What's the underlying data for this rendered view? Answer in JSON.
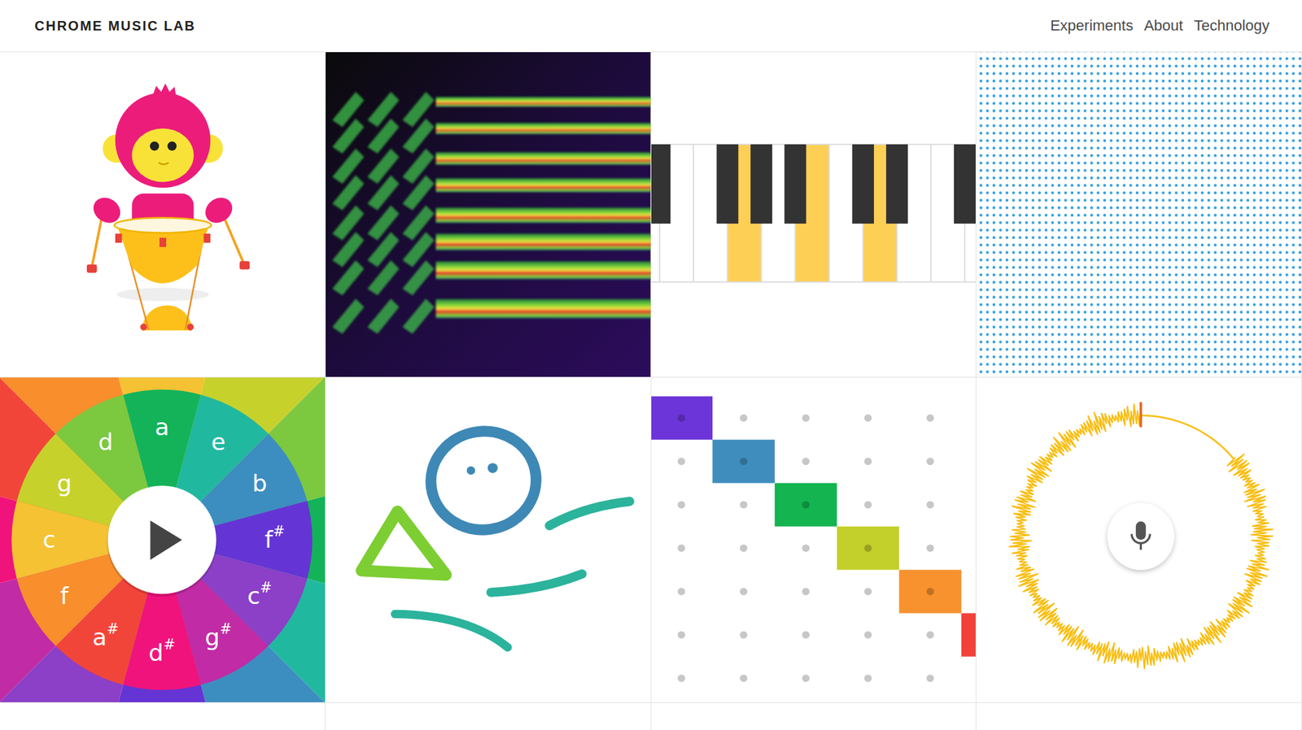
{
  "header": {
    "logo": "CHROME MUSIC LAB",
    "nav": [
      {
        "label": "Experiments"
      },
      {
        "label": "About"
      },
      {
        "label": "Technology"
      }
    ]
  },
  "experiments": [
    {
      "kind": "rhythm"
    },
    {
      "kind": "spectrogram"
    },
    {
      "kind": "chords",
      "keys": [
        {
          "active": false
        },
        {
          "active": false
        },
        {
          "active": false
        },
        {
          "active": true
        },
        {
          "active": false
        },
        {
          "active": true
        },
        {
          "active": false
        },
        {
          "active": true
        },
        {
          "active": false
        },
        {
          "active": false
        },
        {
          "active": false
        }
      ]
    },
    {
      "kind": "sound-waves"
    },
    {
      "kind": "arpeggios",
      "wedges": [
        {
          "note": "a",
          "accidental": "",
          "color": "#14b35a"
        },
        {
          "note": "e",
          "accidental": "",
          "color": "#21b8a0"
        },
        {
          "note": "b",
          "accidental": "",
          "color": "#3d8ec0"
        },
        {
          "note": "f",
          "accidental": "#",
          "color": "#6534d5"
        },
        {
          "note": "c",
          "accidental": "#",
          "color": "#8c3fc7"
        },
        {
          "note": "g",
          "accidental": "#",
          "color": "#c12ba5"
        },
        {
          "note": "d",
          "accidental": "#",
          "color": "#f0137c"
        },
        {
          "note": "a",
          "accidental": "#",
          "color": "#f2453a"
        },
        {
          "note": "f",
          "accidental": "",
          "color": "#f88e2c"
        },
        {
          "note": "c",
          "accidental": "",
          "color": "#f4c233"
        },
        {
          "note": "g",
          "accidental": "",
          "color": "#c6d12b"
        },
        {
          "note": "d",
          "accidental": "",
          "color": "#7cc83f"
        }
      ]
    },
    {
      "kind": "kandinsky"
    },
    {
      "kind": "melody-maker",
      "notes": [
        {
          "row": 0,
          "color": "#6c35d9"
        },
        {
          "row": 1,
          "color": "#3f8dbd"
        },
        {
          "row": 2,
          "color": "#14b450"
        },
        {
          "row": 3,
          "color": "#c3cf2a"
        },
        {
          "row": 4,
          "color": "#f7922f"
        },
        {
          "row": 5,
          "color": "#f2413a"
        }
      ]
    },
    {
      "kind": "voice-spinner"
    }
  ]
}
